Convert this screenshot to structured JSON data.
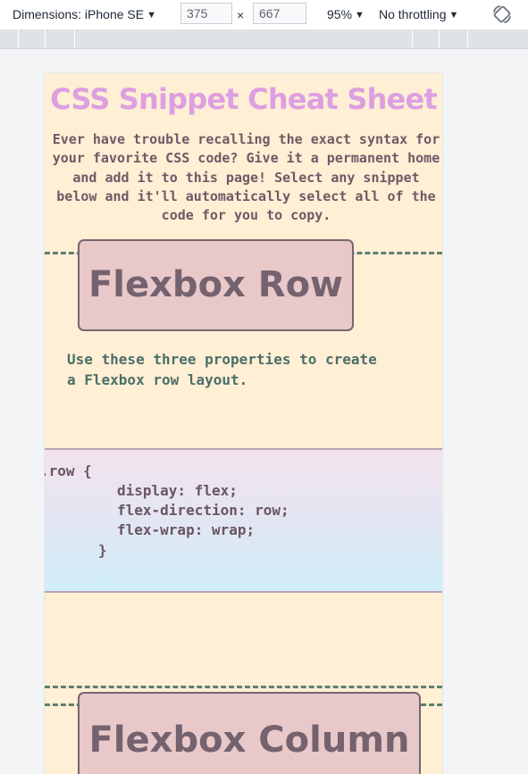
{
  "toolbar": {
    "device_label": "Dimensions: iPhone SE",
    "width_value": "375",
    "height_value": "667",
    "times_symbol": "×",
    "zoom_label": "95%",
    "throttling_label": "No throttling"
  },
  "page": {
    "title": "CSS Snippet Cheat Sheet",
    "intro": "Ever have trouble recalling the exact syntax for your favorite CSS code? Give it a permanent home and add it to this page! Select any snippet below and it'll automatically select all of the code for you to copy.",
    "sections": [
      {
        "heading": "Flexbox Row",
        "description": "Use these three properties to create a Flexbox row layout.",
        "code": [
          ".row {",
          "display: flex;",
          "flex-direction: row;",
          "flex-wrap: wrap;",
          "}"
        ]
      },
      {
        "heading": "Flexbox Column"
      }
    ]
  },
  "colors": {
    "page_background": "#ffefd5",
    "title": "#dd9fe1",
    "heading_box": "#e8c8c9",
    "dashed_line": "#5f7f70",
    "description_text": "#4b6f69"
  },
  "icons": {
    "rotate": "rotate-icon",
    "dropdown": "caret-down-icon"
  }
}
